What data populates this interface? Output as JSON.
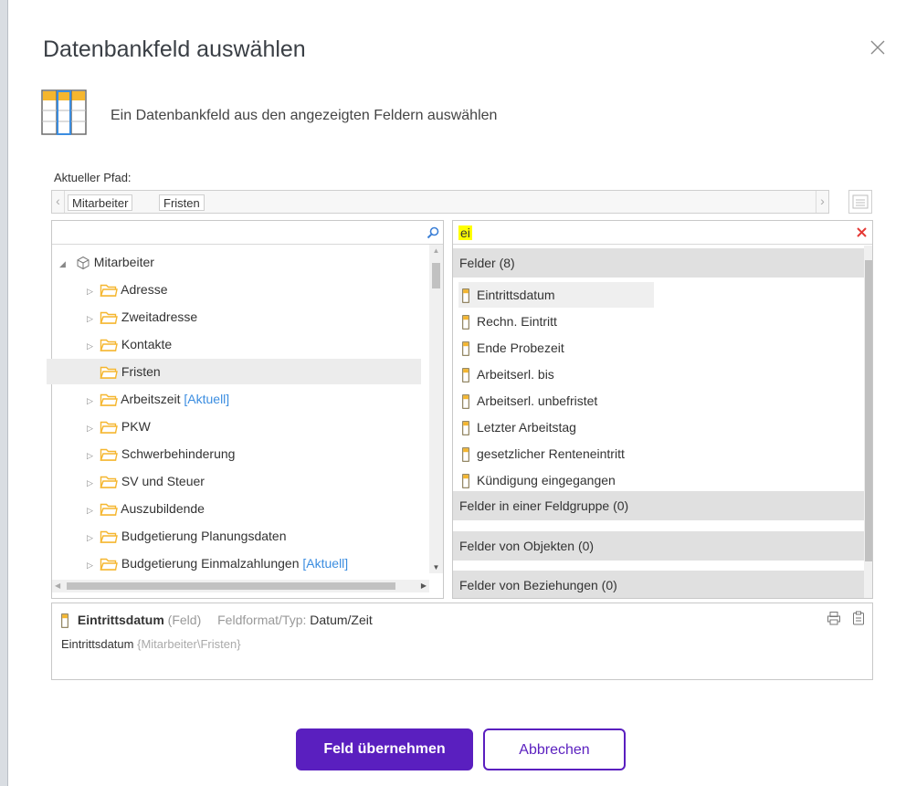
{
  "dialog": {
    "title": "Datenbankfeld auswählen",
    "subtitle": "Ein Datenbankfeld aus den angezeigten Feldern auswählen"
  },
  "path": {
    "label": "Aktueller Pfad:",
    "crumbs": [
      "Mitarbeiter",
      "Fristen"
    ]
  },
  "tree": {
    "root": "Mitarbeiter",
    "items": [
      {
        "label": "Adresse",
        "tag": ""
      },
      {
        "label": "Zweitadresse",
        "tag": ""
      },
      {
        "label": "Kontakte",
        "tag": ""
      },
      {
        "label": "Fristen",
        "tag": ""
      },
      {
        "label": "Arbeitszeit",
        "tag": "[Aktuell]"
      },
      {
        "label": "PKW",
        "tag": ""
      },
      {
        "label": "Schwerbehinderung",
        "tag": ""
      },
      {
        "label": "SV und Steuer",
        "tag": ""
      },
      {
        "label": "Auszubildende",
        "tag": ""
      },
      {
        "label": "Budgetierung Planungsdaten",
        "tag": ""
      },
      {
        "label": "Budgetierung Einmalzahlungen",
        "tag": "[Aktuell]"
      }
    ]
  },
  "fields": {
    "search_value": "ei",
    "sections": [
      "Felder (8)",
      "Felder in einer Feldgruppe (0)",
      "Felder von Objekten (0)",
      "Felder von Beziehungen (0)"
    ],
    "items": [
      "Eintrittsdatum",
      "Rechn. Eintritt",
      "Ende Probezeit",
      "Arbeitserl. bis",
      "Arbeitserl. unbefristet",
      "Letzter Arbeitstag",
      "gesetzlicher Renteneintritt",
      "Kündigung eingegangen"
    ]
  },
  "info": {
    "name": "Eintrittsdatum",
    "kind": "(Feld)",
    "format_label": "Feldformat/Typ:",
    "format_value": "Datum/Zeit",
    "path_name": "Eintrittsdatum",
    "path_value": "{Mitarbeiter\\Fristen}"
  },
  "buttons": {
    "accept": "Feld übernehmen",
    "cancel": "Abbrechen"
  },
  "colors": {
    "accent": "#5a1fbf",
    "folder": "#f5b62e",
    "current_tag": "#3b8de0",
    "search_highlight": "#ffff00",
    "clear_icon": "#e53935"
  }
}
